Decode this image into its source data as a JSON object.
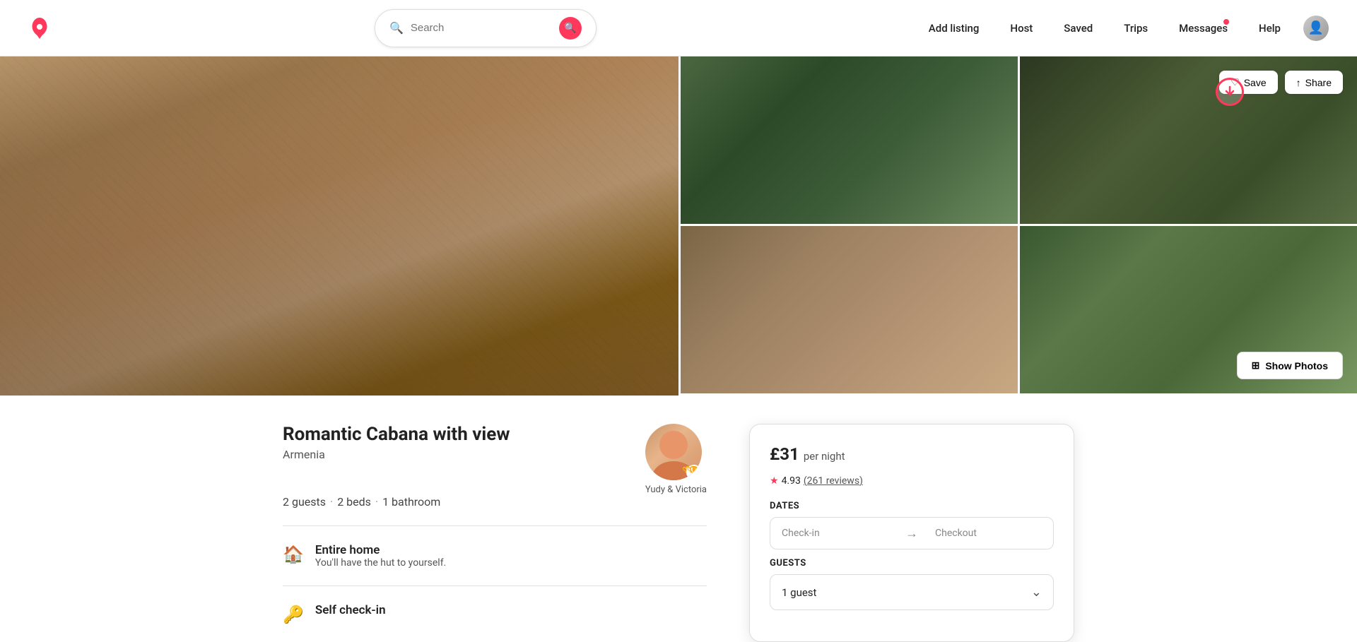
{
  "brand": {
    "name": "Airbnb",
    "logo_color": "#FF385C"
  },
  "navbar": {
    "search_placeholder": "Search",
    "links": [
      {
        "id": "add-listing",
        "label": "Add listing"
      },
      {
        "id": "host",
        "label": "Host"
      },
      {
        "id": "saved",
        "label": "Saved"
      },
      {
        "id": "trips",
        "label": "Trips"
      },
      {
        "id": "messages",
        "label": "Messages"
      },
      {
        "id": "help",
        "label": "Help"
      }
    ]
  },
  "photo_actions": {
    "save_label": "Save",
    "share_label": "Share",
    "show_photos_label": "Show Photos"
  },
  "listing": {
    "title": "Romantic Cabana with view",
    "location": "Armenia",
    "guests": "2 guests",
    "beds": "2 beds",
    "bathrooms": "1 bathroom",
    "entire_home_label": "Entire home",
    "entire_home_sub": "You'll have the hut to yourself.",
    "self_checkin_label": "Self check-in",
    "host": {
      "name": "Yudy & Victoria",
      "badge": "🏆"
    }
  },
  "booking": {
    "price": "£31",
    "price_suffix": "per night",
    "rating": "4.93",
    "review_count": "261 reviews",
    "dates_label": "Dates",
    "checkin_placeholder": "Check-in",
    "checkout_placeholder": "Checkout",
    "guests_label": "Guests",
    "guests_value": "1 guest",
    "arrow": "→"
  }
}
